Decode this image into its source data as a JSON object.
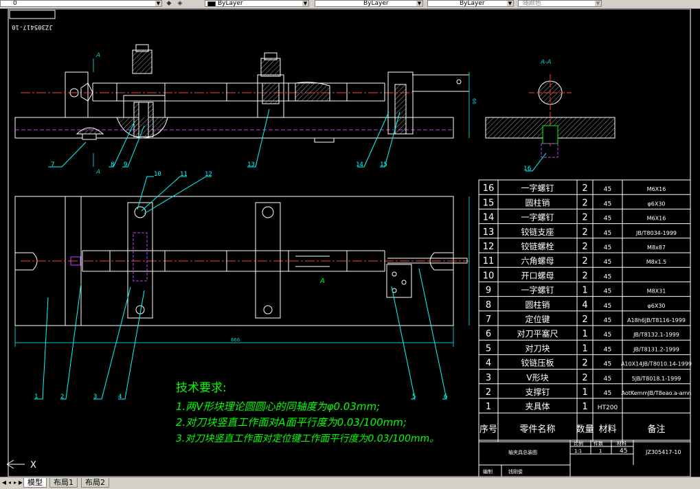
{
  "toolbar": {
    "layer_combo_value": "0",
    "color_combo_value": "ByLayer",
    "linetype_combo_value": "ByLayer",
    "lineweight_combo_value": "ByLayer",
    "plotstyle_combo_value": "随颜色"
  },
  "title_block_rotated": "JZ305417-10",
  "view_labels": {
    "section_top": "A",
    "section_bottom": "A",
    "section_view_title": "A-A"
  },
  "balloons": {
    "front": [
      "7",
      "8",
      "9",
      "13",
      "14",
      "15"
    ],
    "section": [
      "16"
    ],
    "plan_top": [
      "10",
      "11",
      "12"
    ],
    "plan_bottom": [
      "1",
      "2",
      "3",
      "4",
      "5",
      "6"
    ]
  },
  "dimensions": {
    "overall_length": "666",
    "marker_a": "A"
  },
  "tech_requirements": {
    "title": "技术要求:",
    "lines": [
      "1.两V形块理论圆圆心的同轴度为φ0.03mm;",
      "2.对刀块竖直工作面对A面平行度为0.03/100mm;",
      "3.对刀块竖直工作面对定位键工作面平行度为0.03/100mm。"
    ]
  },
  "bom": {
    "rows": [
      {
        "no": "16",
        "name": "一字螺钉",
        "qty": "2",
        "mat": "45",
        "note": "M6X16"
      },
      {
        "no": "15",
        "name": "圆柱销",
        "qty": "2",
        "mat": "45",
        "note": "φ6X30"
      },
      {
        "no": "14",
        "name": "一字螺钉",
        "qty": "2",
        "mat": "45",
        "note": "M6X16"
      },
      {
        "no": "13",
        "name": "铰链支座",
        "qty": "2",
        "mat": "45",
        "note": "JB/T8034-1999"
      },
      {
        "no": "12",
        "name": "铰链螺栓",
        "qty": "2",
        "mat": "45",
        "note": "M8x87"
      },
      {
        "no": "11",
        "name": "六角螺母",
        "qty": "2",
        "mat": "45",
        "note": "M8x1.5"
      },
      {
        "no": "10",
        "name": "开口螺母",
        "qty": "2",
        "mat": "45",
        "note": ""
      },
      {
        "no": "9",
        "name": "一字螺钉",
        "qty": "1",
        "mat": "45",
        "note": "M8X31"
      },
      {
        "no": "8",
        "name": "圆柱销",
        "qty": "4",
        "mat": "45",
        "note": "φ6X30"
      },
      {
        "no": "7",
        "name": "定位键",
        "qty": "2",
        "mat": "45",
        "note": "A18h6JB/T8116-1999"
      },
      {
        "no": "6",
        "name": "对刀平塞尺",
        "qty": "1",
        "mat": "45",
        "note": "JB/T8132.1-1999"
      },
      {
        "no": "5",
        "name": "对刀块",
        "qty": "1",
        "mat": "45",
        "note": "JB/T8131.2-1999"
      },
      {
        "no": "4",
        "name": "铰链压板",
        "qty": "2",
        "mat": "45",
        "note": "A10X14JB/T8010.14-1999"
      },
      {
        "no": "3",
        "name": "V形块",
        "qty": "2",
        "mat": "45",
        "note": "5JB/T8018.1-1999"
      },
      {
        "no": "2",
        "name": "支撑钉",
        "qty": "1",
        "mat": "45",
        "note": "AotKemmJB/T8eao.a-amn"
      },
      {
        "no": "1",
        "name": "夹具体",
        "qty": "1",
        "mat": "HT200",
        "note": ""
      }
    ],
    "header": {
      "no": "序号",
      "name": "零件名称",
      "qty": "数量",
      "mat": "材料",
      "note": "备注"
    },
    "title_block": {
      "drawing_name": "轴夹具总装图",
      "scale_label": "比例",
      "qty_label": "件数",
      "mat_label": "材料",
      "scale": "1:1",
      "qty": "1",
      "mat": "45",
      "code": "JZ305417-10",
      "designer_label": "编制",
      "designer": "钱刚俊"
    }
  },
  "ucs_label": "X",
  "tabs": [
    "模型",
    "布局1",
    "布局2"
  ],
  "colors": {
    "background": "#000000",
    "outline": "#ffffff",
    "centerline": "#ff4040",
    "hidden": "#c040ff",
    "dimension": "#00c8c8",
    "hatch": "#a0a0a0",
    "leader": "#00ffff",
    "text": "#00ff00"
  }
}
